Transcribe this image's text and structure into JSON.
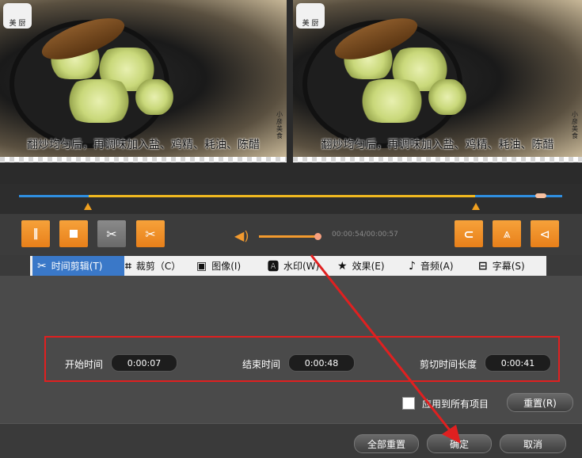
{
  "preview": {
    "subtitle_left": "翻炒均匀后，再调味加入盐、鸡精、耗油、陈醋",
    "subtitle_right": "翻炒均匀后，再调味加入盐、鸡精、耗油、陈醋",
    "logo_text": "美 厨",
    "watermark_vertical": "小彦美食"
  },
  "player": {
    "time_display": "00:00:54/00:00:57",
    "volume_level": 0.9
  },
  "tabs": [
    {
      "label": "时间剪辑(T)",
      "icon": "scissors-icon"
    },
    {
      "label": "裁剪（C）",
      "icon": "crop-icon"
    },
    {
      "label": "图像(I)",
      "icon": "image-icon"
    },
    {
      "label": "水印(W)",
      "icon": "watermark-icon"
    },
    {
      "label": "效果(E)",
      "icon": "star-icon"
    },
    {
      "label": "音频(A)",
      "icon": "music-note-icon"
    },
    {
      "label": "字幕(S)",
      "icon": "subtitle-icon"
    }
  ],
  "trim": {
    "start_label": "开始时间",
    "start_value": "0:00:07",
    "end_label": "结束时间",
    "end_value": "0:00:48",
    "duration_label": "剪切时间长度",
    "duration_value": "0:00:41"
  },
  "apply_all_label": "应用到所有项目",
  "reset_label": "重置(R)",
  "footer": {
    "reset_all": "全部重置",
    "ok": "确定",
    "cancel": "取消"
  },
  "colors": {
    "accent_orange": "#f39a2e",
    "highlight_red": "#e02020",
    "timeline_blue": "#2f8ee0",
    "timeline_yellow": "#f0b820"
  }
}
